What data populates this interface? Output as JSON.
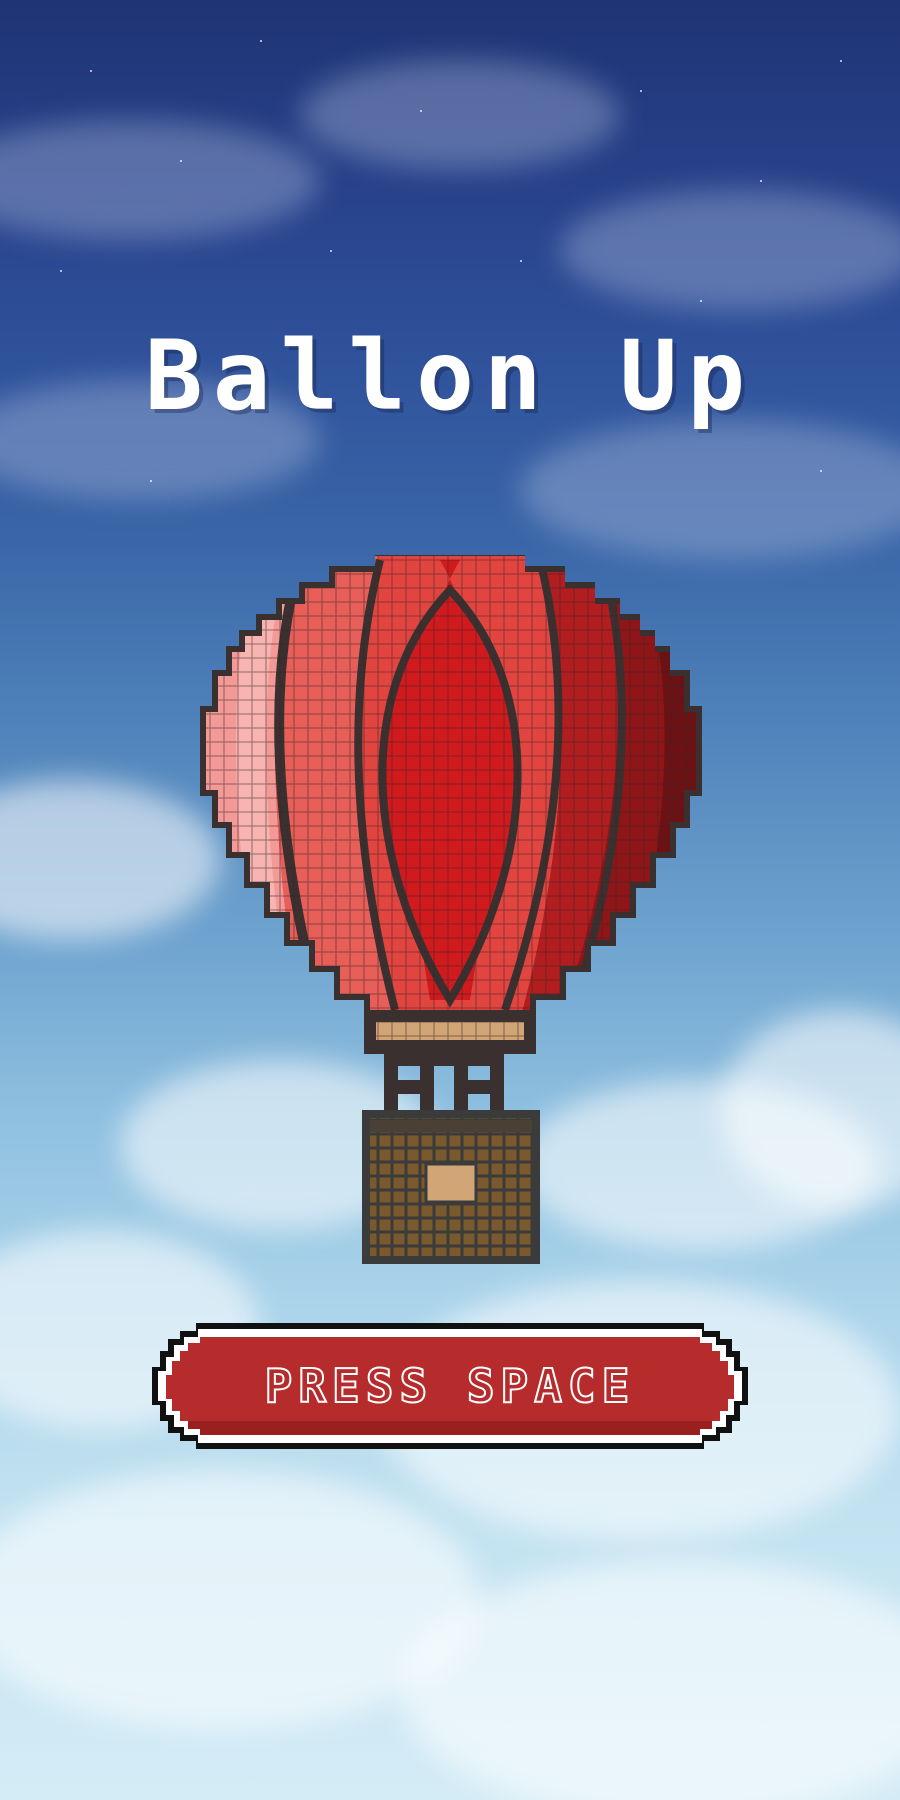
{
  "game": {
    "title": "Ballon Up",
    "start_prompt": "PRESS SPACE"
  },
  "sprites": {
    "player": "hot-air-balloon-icon"
  },
  "colors": {
    "button_fill": "#b62b2b",
    "button_outline": "#111111",
    "title_text": "#ffffff",
    "balloon_light": "#f39a98",
    "balloon_mid": "#e2443f",
    "balloon_main": "#d11a1d",
    "balloon_dark": "#8f1618",
    "basket": "#7a5a2c",
    "band": "#d2a577"
  }
}
